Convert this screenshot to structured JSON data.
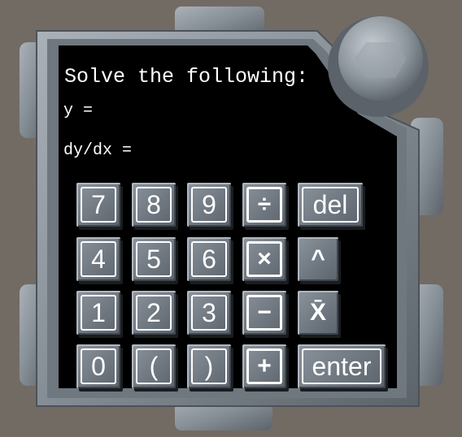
{
  "screen": {
    "prompt": "Solve the following:",
    "y_label": "y =",
    "dydx_label": "dy/dx ="
  },
  "keypad": {
    "rows": [
      [
        {
          "label": "7",
          "name": "key-7"
        },
        {
          "label": "8",
          "name": "key-8"
        },
        {
          "label": "9",
          "name": "key-9"
        },
        {
          "label": "÷",
          "name": "key-divide"
        },
        {
          "label": "del",
          "name": "key-delete"
        }
      ],
      [
        {
          "label": "4",
          "name": "key-4"
        },
        {
          "label": "5",
          "name": "key-5"
        },
        {
          "label": "6",
          "name": "key-6"
        },
        {
          "label": "×",
          "name": "key-multiply"
        },
        {
          "label": "^",
          "name": "key-power"
        }
      ],
      [
        {
          "label": "1",
          "name": "key-1"
        },
        {
          "label": "2",
          "name": "key-2"
        },
        {
          "label": "3",
          "name": "key-3"
        },
        {
          "label": "−",
          "name": "key-minus"
        },
        {
          "label": "X̄",
          "name": "key-x-bar"
        }
      ],
      [
        {
          "label": "0",
          "name": "key-0"
        },
        {
          "label": "(",
          "name": "key-open-paren"
        },
        {
          "label": ")",
          "name": "key-close-paren"
        },
        {
          "label": "+",
          "name": "key-plus"
        },
        {
          "label": "enter",
          "name": "key-enter"
        }
      ]
    ]
  },
  "colors": {
    "background": "#726b64",
    "screen": "#000000",
    "frame": "#8c949c",
    "key": "#7a828b",
    "text": "#ffffff"
  }
}
